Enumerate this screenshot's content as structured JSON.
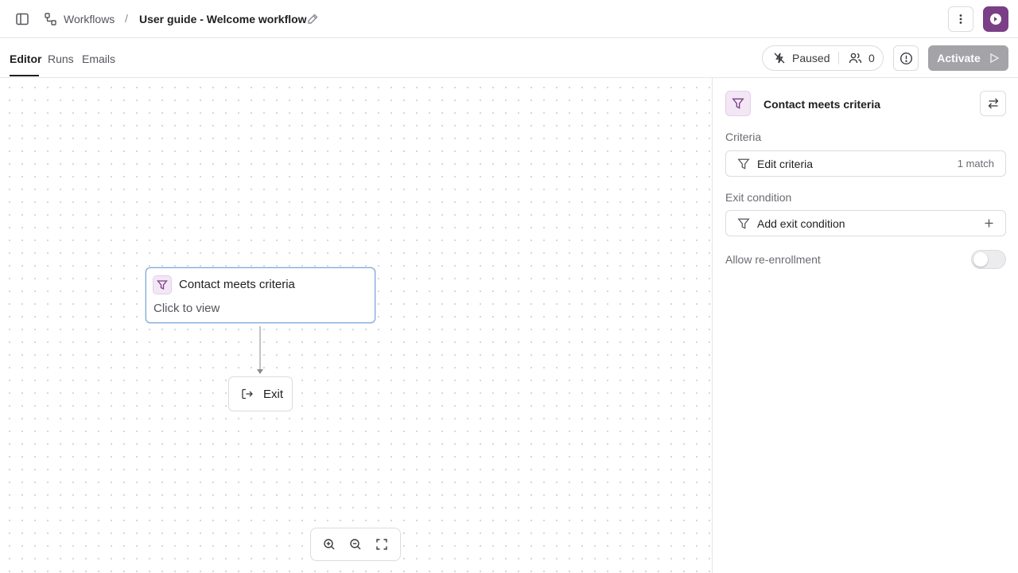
{
  "header": {
    "breadcrumb_root": "Workflows",
    "breadcrumb_separator": "/",
    "title": "User guide - Welcome workflow"
  },
  "tabs": [
    {
      "label": "Editor",
      "active": true
    },
    {
      "label": "Runs",
      "active": false
    },
    {
      "label": "Emails",
      "active": false
    }
  ],
  "status": {
    "state_label": "Paused",
    "enrolled_count": "0",
    "activate_label": "Activate"
  },
  "canvas": {
    "criteria_node": {
      "title": "Contact meets criteria",
      "subtitle": "Click to view"
    },
    "exit_node": {
      "label": "Exit"
    }
  },
  "panel": {
    "title": "Contact meets criteria",
    "criteria_section_label": "Criteria",
    "edit_criteria_label": "Edit criteria",
    "match_count": "1 match",
    "exit_section_label": "Exit condition",
    "add_exit_label": "Add exit condition",
    "reenroll_label": "Allow re-enrollment",
    "reenroll_enabled": false
  },
  "colors": {
    "accent": "#7a3f86",
    "node_border": "#7ea7d8",
    "activate_disabled": "#a3a3a8"
  },
  "icons": {
    "sidebar_toggle": "sidebar-toggle-icon",
    "workflow": "workflow-icon",
    "edit": "pencil-icon",
    "more": "more-vertical-icon",
    "paused": "bolt-off-icon",
    "users": "users-icon",
    "info": "info-icon",
    "play": "play-icon",
    "filter": "filter-icon",
    "exit": "exit-icon",
    "swap": "swap-icon",
    "plus": "plus-icon",
    "zoom_in": "zoom-in-icon",
    "zoom_out": "zoom-out-icon",
    "fit": "fit-screen-icon"
  }
}
